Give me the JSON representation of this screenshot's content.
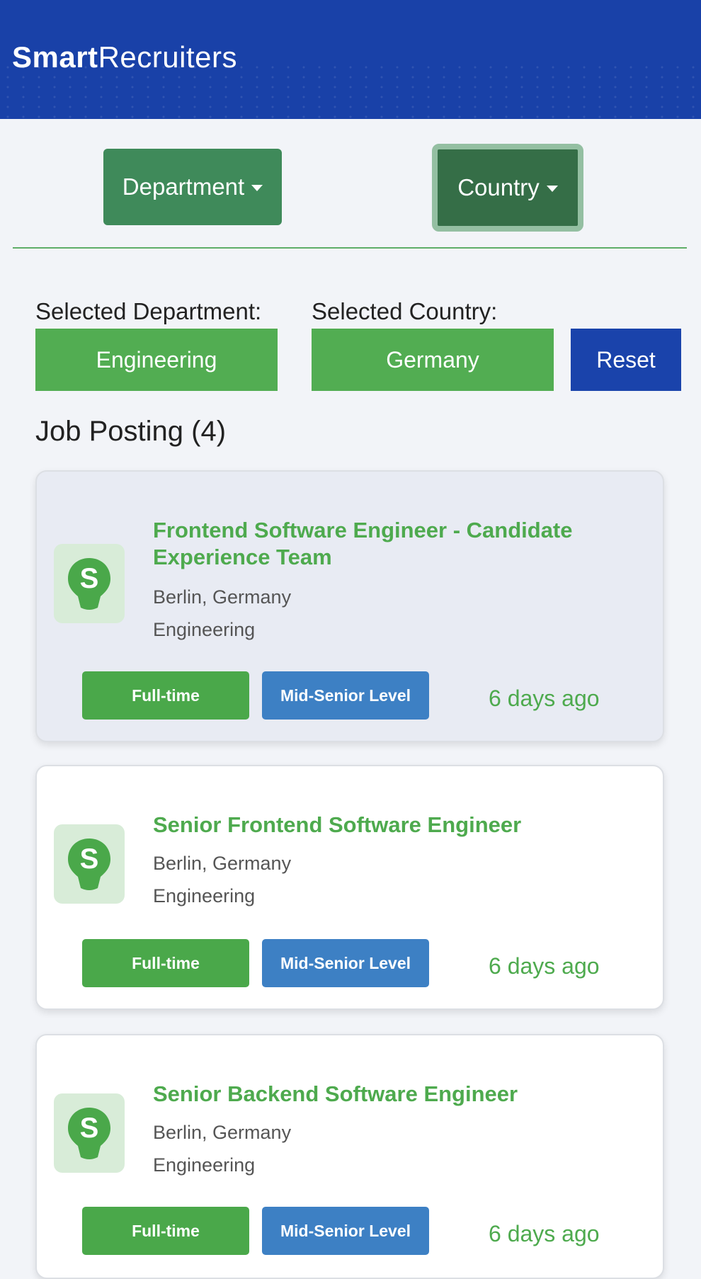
{
  "header": {
    "brand_bold": "Smart",
    "brand_light": "Recruiters"
  },
  "filters": {
    "department_label": "Department",
    "country_label": "Country",
    "selected_department_label": "Selected Department:",
    "selected_country_label": "Selected Country:",
    "selected_department": "Engineering",
    "selected_country": "Germany",
    "reset_label": "Reset"
  },
  "jobs": {
    "title": "Job Posting (4)",
    "items": [
      {
        "title": "Frontend Software Engineer - Candidate Experience Team",
        "location": "Berlin, Germany",
        "department": "Engineering",
        "type": "Full-time",
        "level": "Mid-Senior Level",
        "posted": "6 days ago"
      },
      {
        "title": "Senior Frontend Software Engineer",
        "location": "Berlin, Germany",
        "department": "Engineering",
        "type": "Full-time",
        "level": "Mid-Senior Level",
        "posted": "6 days ago"
      },
      {
        "title": "Senior Backend Software Engineer",
        "location": "Berlin, Germany",
        "department": "Engineering",
        "type": "Full-time",
        "level": "Mid-Senior Level",
        "posted": "6 days ago"
      }
    ]
  },
  "colors": {
    "header_bg": "#1941a8",
    "accent_green": "#4eaa4e",
    "dropdown_green": "#3f8a5a",
    "tag_blue": "#3d80c4"
  }
}
